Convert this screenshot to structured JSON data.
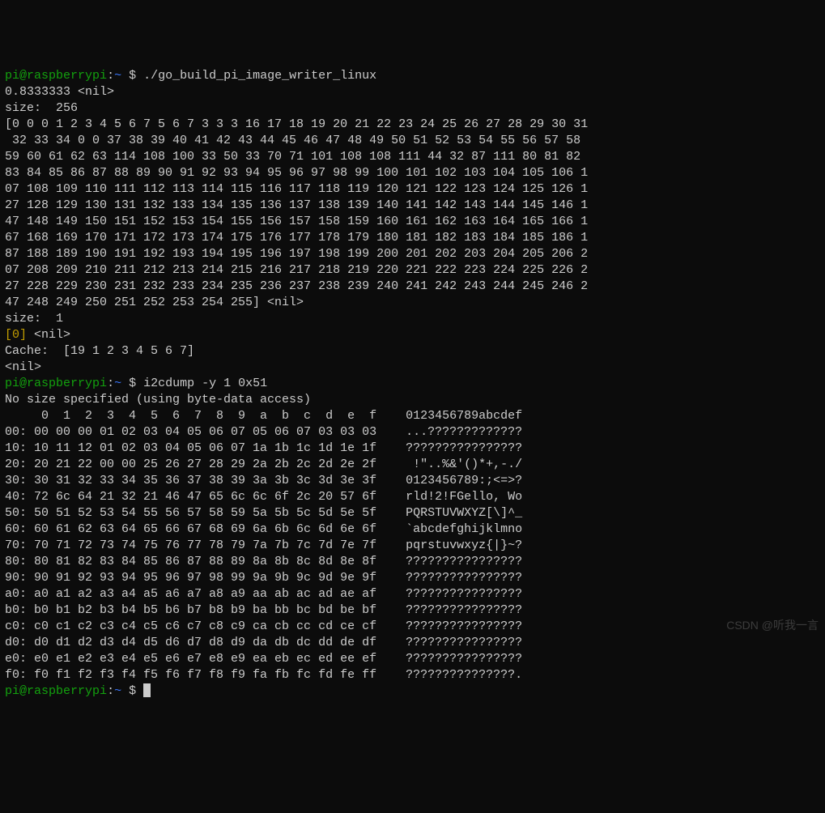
{
  "prompt": {
    "user": "pi",
    "at": "@",
    "host": "raspberrypi",
    "colon": ":",
    "cwd": "~",
    "dollar": " $ "
  },
  "cmd1": "./go_build_pi_image_writer_linux",
  "out1_line1": "0.8333333 <nil>",
  "out1_line2": "size:  256",
  "out1_array": [
    "[0 0 0 1 2 3 4 5 6 7 5 6 7 3 3 3 16 17 18 19 20 21 22 23 24 25 26 27 28 29 30 31",
    " 32 33 34 0 0 37 38 39 40 41 42 43 44 45 46 47 48 49 50 51 52 53 54 55 56 57 58 ",
    "59 60 61 62 63 114 108 100 33 50 33 70 71 101 108 108 111 44 32 87 111 80 81 82 ",
    "83 84 85 86 87 88 89 90 91 92 93 94 95 96 97 98 99 100 101 102 103 104 105 106 1",
    "07 108 109 110 111 112 113 114 115 116 117 118 119 120 121 122 123 124 125 126 1",
    "27 128 129 130 131 132 133 134 135 136 137 138 139 140 141 142 143 144 145 146 1",
    "47 148 149 150 151 152 153 154 155 156 157 158 159 160 161 162 163 164 165 166 1",
    "67 168 169 170 171 172 173 174 175 176 177 178 179 180 181 182 183 184 185 186 1",
    "87 188 189 190 191 192 193 194 195 196 197 198 199 200 201 202 203 204 205 206 2",
    "07 208 209 210 211 212 213 214 215 216 217 218 219 220 221 222 223 224 225 226 2",
    "27 228 229 230 231 232 233 234 235 236 237 238 239 240 241 242 243 244 245 246 2",
    "47 248 249 250 251 252 253 254 255] <nil>"
  ],
  "out1_line3": "size:  1",
  "out1_line4_left": "[0]",
  "out1_line4_right": " <nil>",
  "out1_line5": "Cache:  [19 1 2 3 4 5 6 7]",
  "out1_line6": "<nil>",
  "cmd2": "i2cdump -y 1 0x51",
  "out2_line1": "No size specified (using byte-data access)",
  "out2_header": "     0  1  2  3  4  5  6  7  8  9  a  b  c  d  e  f    0123456789abcdef",
  "out2_rows": [
    "00: 00 00 00 01 02 03 04 05 06 07 05 06 07 03 03 03    ...?????????????",
    "10: 10 11 12 01 02 03 04 05 06 07 1a 1b 1c 1d 1e 1f    ????????????????",
    "20: 20 21 22 00 00 25 26 27 28 29 2a 2b 2c 2d 2e 2f     !\"..%&'()*+,-./",
    "30: 30 31 32 33 34 35 36 37 38 39 3a 3b 3c 3d 3e 3f    0123456789:;<=>?",
    "40: 72 6c 64 21 32 21 46 47 65 6c 6c 6f 2c 20 57 6f    rld!2!FGello, Wo",
    "50: 50 51 52 53 54 55 56 57 58 59 5a 5b 5c 5d 5e 5f    PQRSTUVWXYZ[\\]^_",
    "60: 60 61 62 63 64 65 66 67 68 69 6a 6b 6c 6d 6e 6f    `abcdefghijklmno",
    "70: 70 71 72 73 74 75 76 77 78 79 7a 7b 7c 7d 7e 7f    pqrstuvwxyz{|}~?",
    "80: 80 81 82 83 84 85 86 87 88 89 8a 8b 8c 8d 8e 8f    ????????????????",
    "90: 90 91 92 93 94 95 96 97 98 99 9a 9b 9c 9d 9e 9f    ????????????????",
    "a0: a0 a1 a2 a3 a4 a5 a6 a7 a8 a9 aa ab ac ad ae af    ????????????????",
    "b0: b0 b1 b2 b3 b4 b5 b6 b7 b8 b9 ba bb bc bd be bf    ????????????????",
    "c0: c0 c1 c2 c3 c4 c5 c6 c7 c8 c9 ca cb cc cd ce cf    ????????????????",
    "d0: d0 d1 d2 d3 d4 d5 d6 d7 d8 d9 da db dc dd de df    ????????????????",
    "e0: e0 e1 e2 e3 e4 e5 e6 e7 e8 e9 ea eb ec ed ee ef    ????????????????",
    "f0: f0 f1 f2 f3 f4 f5 f6 f7 f8 f9 fa fb fc fd fe ff    ???????????????."
  ],
  "watermark": "CSDN @听我一言"
}
